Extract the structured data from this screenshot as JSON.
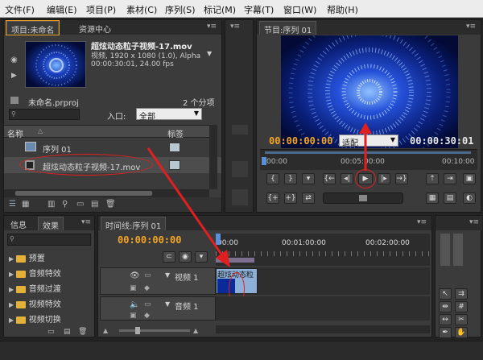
{
  "menu": [
    "文件(F)",
    "编辑(E)",
    "项目(P)",
    "素材(C)",
    "序列(S)",
    "标记(M)",
    "字幕(T)",
    "窗口(W)",
    "帮助(H)"
  ],
  "project": {
    "tab_active": "项目:未命名",
    "tab_other": "资源中心",
    "clip_name": "超炫动态粒子视频-17.mov",
    "clip_info1": "视频, 1920 x 1080 (1.0), Alpha",
    "clip_info2": "00:00:30:01, 24.00 fps",
    "proj_file": "未命名.prproj",
    "item_count": "2 个分项",
    "inlet_label": "入口:",
    "inlet_value": "全部",
    "col_name": "名称",
    "col_label": "标签",
    "items": [
      {
        "name": "序列 01",
        "icon": "sequence-icon"
      },
      {
        "name": "超炫动态粒子视频-17.mov",
        "icon": "film-icon"
      }
    ]
  },
  "program": {
    "tab": "节目:序列 01",
    "tc_current": "00:00:00:00",
    "fit": "适配",
    "tc_duration": "00:00:30:01",
    "ruler": [
      "00:00",
      "00:05:00:00",
      "00:10:00"
    ]
  },
  "effects": {
    "tab_info": "信息",
    "tab_effects": "效果",
    "folders": [
      "预置",
      "音频特效",
      "音频过渡",
      "视频特效",
      "视频切换"
    ]
  },
  "timeline": {
    "tab": "时间线:序列 01",
    "tc": "00:00:00:00",
    "ruler": [
      "00:00",
      "00:01:00:00",
      "00:02:00:00"
    ],
    "video_track": "视频 1",
    "audio_track": "音频 1",
    "clip_label": "超炫动态粒"
  },
  "colors": {
    "accent": "#f5a623",
    "highlight": "#e02020",
    "folder": "#e3b13a"
  }
}
